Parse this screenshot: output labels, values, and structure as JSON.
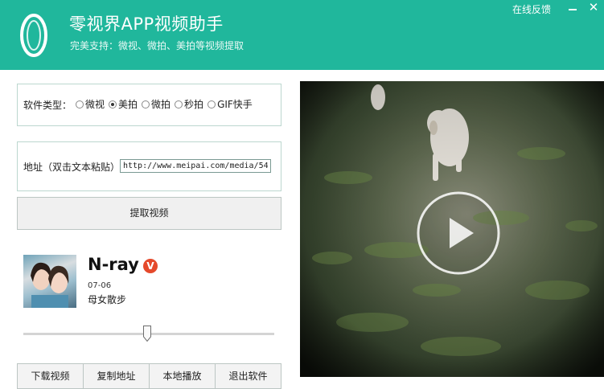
{
  "header": {
    "title": "零视界APP视频助手",
    "subtitle": "完美支持：微视、微拍、美拍等视频提取",
    "feedback_link": "在线反馈",
    "bg_color": "#20b79c"
  },
  "window_controls": {
    "minimize_icon": "minimize-icon",
    "close_icon": "close-icon",
    "close_glyph": "✕"
  },
  "software_type": {
    "label": "软件类型：",
    "options": [
      {
        "label": "微视",
        "checked": false
      },
      {
        "label": "美拍",
        "checked": true
      },
      {
        "label": "微拍",
        "checked": false
      },
      {
        "label": "秒拍",
        "checked": false
      },
      {
        "label": "GIF快手",
        "checked": false
      }
    ]
  },
  "address": {
    "label": "地址（双击文本粘贴）",
    "value": "http://www.meipai.com/media/54"
  },
  "fetch_button": "提取视频",
  "video_info": {
    "author": "N-ray",
    "verified_badge": "V",
    "date": "07-06",
    "title": "母女散步"
  },
  "slider": {
    "value_percent": 50
  },
  "bottom_buttons": [
    "下载视频",
    "复制地址",
    "本地播放",
    "退出软件"
  ],
  "video": {
    "play_icon": "play-icon"
  }
}
